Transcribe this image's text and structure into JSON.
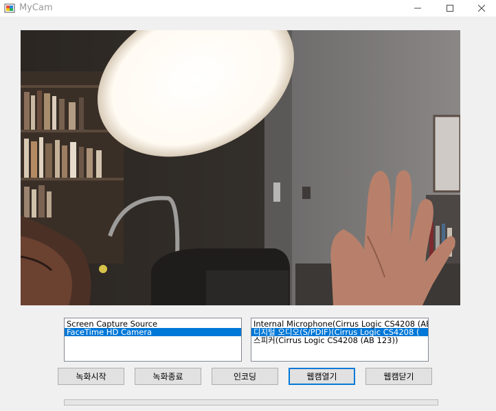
{
  "window": {
    "title": "MyCam",
    "icon": "app-window-icon",
    "controls": [
      "minimize-icon",
      "maximize-icon",
      "close-icon"
    ]
  },
  "video_sources": {
    "items": [
      {
        "label": "Screen Capture Source",
        "selected": false
      },
      {
        "label": "FaceTime HD Camera",
        "selected": true
      }
    ]
  },
  "audio_sources": {
    "items": [
      {
        "label": "Internal Microphone(Cirrus Logic CS4208 (AB",
        "selected": false
      },
      {
        "label": "디지털 오디오(S/PDIF)(Cirrus Logic CS4208 (",
        "selected": true
      },
      {
        "label": "스피커(Cirrus Logic CS4208 (AB 123))",
        "selected": false
      }
    ]
  },
  "buttons": {
    "start_recording": "녹화시작",
    "stop_recording": "녹화종료",
    "encoding": "인코딩",
    "open_webcam": "웹캠열기",
    "close_webcam": "웹캠닫기"
  },
  "progress": {
    "value": 0
  },
  "colors": {
    "selection": "#0078d7",
    "window_bg": "#f0f0f0",
    "progress_fill": "#06b025"
  }
}
